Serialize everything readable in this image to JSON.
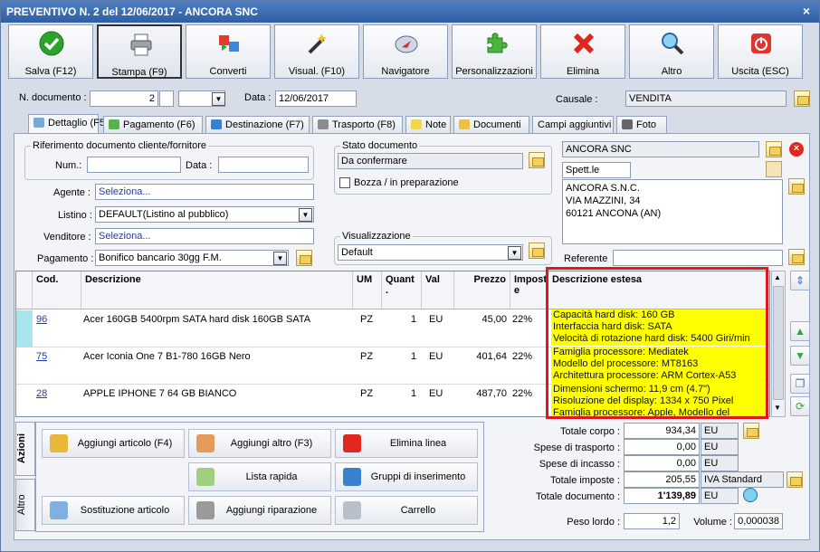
{
  "window": {
    "title": "PREVENTIVO N. 2 del 12/06/2017 - ANCORA SNC",
    "close": "×"
  },
  "toolbar": [
    {
      "label": "Salva (F12)",
      "icon": "check-icon"
    },
    {
      "label": "Stampa (F9)",
      "icon": "printer-icon"
    },
    {
      "label": "Converti",
      "icon": "convert-icon"
    },
    {
      "label": "Visual. (F10)",
      "icon": "magic-wand-icon"
    },
    {
      "label": "Navigatore",
      "icon": "compass-icon"
    },
    {
      "label": "Personalizzazioni",
      "icon": "puzzle-icon"
    },
    {
      "label": "Elimina",
      "icon": "delete-x-icon"
    },
    {
      "label": "Altro",
      "icon": "magnifier-icon"
    },
    {
      "label": "Uscita (ESC)",
      "icon": "power-icon"
    }
  ],
  "doc": {
    "num_label": "N. documento :",
    "num": "2",
    "date_label": "Data :",
    "date": "12/06/2017",
    "causale_label": "Causale :",
    "causale": "VENDITA"
  },
  "tabs": [
    "Dettaglio (F5)",
    "Pagamento (F6)",
    "Destinazione (F7)",
    "Trasporto (F8)",
    "Note",
    "Documenti",
    "Campi aggiuntivi",
    "Foto"
  ],
  "rif": {
    "title": "Riferimento documento cliente/fornitore",
    "num_label": "Num.:",
    "data_label": "Data :"
  },
  "stato": {
    "title": "Stato documento",
    "value": "Da confermare",
    "bozza": "Bozza / in preparazione"
  },
  "fields": {
    "agente_label": "Agente :",
    "agente": "Seleziona...",
    "listino_label": "Listino :",
    "listino": "DEFAULT(Listino al pubblico)",
    "venditore_label": "Venditore :",
    "venditore": "Seleziona...",
    "pagamento_label": "Pagamento :",
    "pagamento": "Bonifico bancario 30gg F.M."
  },
  "visual": {
    "title": "Visualizzazione",
    "value": "Default"
  },
  "cliente": {
    "name": "ANCORA SNC",
    "code": "Spett.le",
    "address": [
      "ANCORA S.N.C.",
      "VIA MAZZINI, 34",
      "60121 ANCONA (AN)"
    ],
    "ref_label": "Referente"
  },
  "grid": {
    "headers": [
      "Cod.",
      "Descrizione",
      "UM",
      "Quant .",
      "Val",
      "Prezzo",
      "Impost e",
      "Descrizione estesa"
    ],
    "rows": [
      {
        "cod": "96",
        "desc": "Acer 160GB 5400rpm SATA hard disk 160GB SATA",
        "um": "PZ",
        "qty": "1",
        "val": "EU",
        "prezzo": "45,00",
        "imp": "22%",
        "ext": [
          "Capacità hard disk: 160 GB",
          "Interfaccia hard disk: SATA",
          "Velocità di rotazione hard disk: 5400 Giri/min"
        ]
      },
      {
        "cod": "75",
        "desc": "Acer Iconia One 7 B1-780 16GB Nero",
        "um": "PZ",
        "qty": "1",
        "val": "EU",
        "prezzo": "401,64",
        "imp": "22%",
        "ext": [
          "Famiglia processore: Mediatek",
          "Modello del processore: MT8163",
          "Architettura processore: ARM Cortex-A53"
        ]
      },
      {
        "cod": "28",
        "desc": "APPLE IPHONE 7 64 GB BIANCO",
        "um": "PZ",
        "qty": "1",
        "val": "EU",
        "prezzo": "487,70",
        "imp": "22%",
        "ext": [
          "Dimensioni schermo: 11,9 cm (4.7\")",
          "Risoluzione del display: 1334 x 750 Pixel",
          "Famiglia processore: Apple, Modello del"
        ]
      }
    ]
  },
  "actions": {
    "tab_azioni": "Azioni",
    "tab_altro": "Altro",
    "buttons": [
      "Aggiungi articolo (F4)",
      "Aggiungi altro (F3)",
      "Elimina linea",
      "Lista rapida",
      "Gruppi di inserimento",
      "Sostituzione articolo",
      "Aggiungi riparazione",
      "Carrello"
    ]
  },
  "totals": {
    "corpo_label": "Totale corpo :",
    "corpo": "934,34",
    "trasporto_label": "Spese di trasporto :",
    "trasporto": "0,00",
    "incasso_label": "Spese di incasso :",
    "incasso": "0,00",
    "imposte_label": "Totale imposte :",
    "imposte": "205,55",
    "iva": "IVA Standard",
    "documento_label": "Totale documento :",
    "documento": "1'139,89",
    "eu": "EU",
    "peso_label": "Peso lordo :",
    "peso": "1,2",
    "volume_label": "Volume :",
    "volume": "0,000038"
  }
}
